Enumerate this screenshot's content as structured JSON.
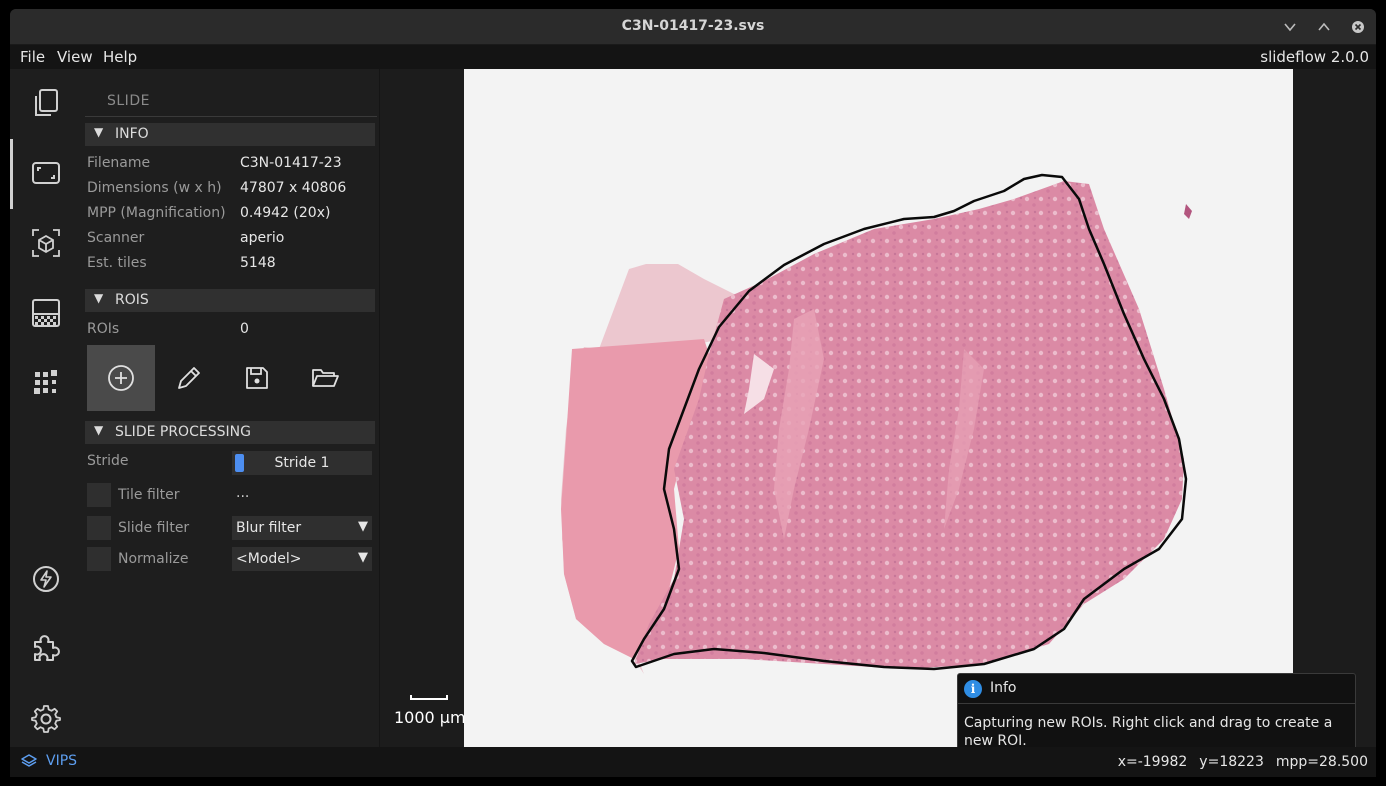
{
  "window": {
    "title": "C3N-01417-23.svs"
  },
  "menu": {
    "file": "File",
    "view": "View",
    "help": "Help",
    "version": "slideflow 2.0.0"
  },
  "sidebar_icons": [
    "documents-icon",
    "slide-icon",
    "model-cube-icon",
    "heatmap-icon",
    "mosaic-icon",
    "lightning-icon",
    "extensions-icon",
    "settings-icon"
  ],
  "panel": {
    "title": "SLIDE",
    "info": {
      "header": "INFO",
      "rows": [
        {
          "key": "Filename",
          "value": "C3N-01417-23"
        },
        {
          "key": "Dimensions (w x h)",
          "value": "47807 x 40806"
        },
        {
          "key": "MPP (Magnification)",
          "value": "0.4942 (20x)"
        },
        {
          "key": "Scanner",
          "value": "aperio"
        },
        {
          "key": "Est. tiles",
          "value": "5148"
        }
      ]
    },
    "rois": {
      "header": "ROIS",
      "label": "ROIs",
      "count": "0"
    },
    "processing": {
      "header": "SLIDE PROCESSING",
      "stride_label": "Stride",
      "stride_value": "Stride 1",
      "tile_filter_label": "Tile filter",
      "tile_filter_value": "...",
      "slide_filter_label": "Slide filter",
      "slide_filter_value": "Blur filter",
      "normalize_label": "Normalize",
      "normalize_value": "<Model>"
    }
  },
  "viewer": {
    "scale_label": "1000 µm"
  },
  "toast": {
    "title": "Info",
    "message": "Capturing new ROIs. Right click and drag to create a new ROI."
  },
  "status": {
    "backend": "VIPS",
    "x": "x=-19982",
    "y": "y=18223",
    "mpp": "mpp=28.500"
  },
  "colors": {
    "accent": "#4d8ef0",
    "info": "#2f8de4",
    "tissue": "#e08aa8"
  }
}
